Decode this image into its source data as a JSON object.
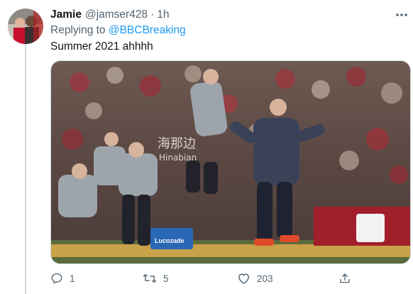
{
  "tweet": {
    "display_name": "Jamie",
    "handle": "@jamser428",
    "separator": "·",
    "time": "1h",
    "reply_prefix": "Replying to ",
    "reply_to": "@BBCBreaking",
    "text": "Summer 2021 ahhhh"
  },
  "media": {
    "watermark": "海那边",
    "watermark_sub": "Hinabian",
    "cooler_label": "Lucozade"
  },
  "actions": {
    "reply_count": "1",
    "retweet_count": "5",
    "like_count": "203"
  },
  "icons": [
    "more-icon",
    "reply-icon",
    "retweet-icon",
    "like-icon",
    "share-icon"
  ],
  "colors": {
    "link": "#1d9bf0",
    "secondary_text": "#536471",
    "primary_text": "#0f1419"
  }
}
